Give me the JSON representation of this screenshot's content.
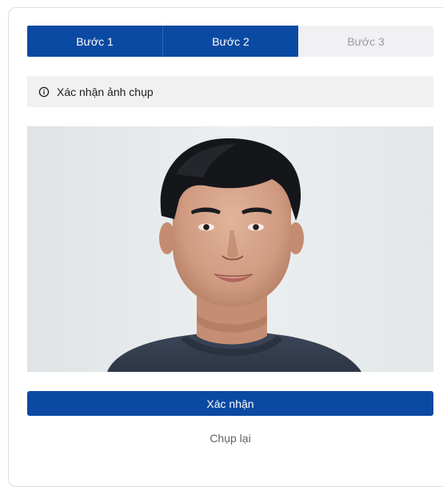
{
  "stepper": {
    "steps": [
      {
        "label": "Bước 1",
        "state": "active"
      },
      {
        "label": "Bước 2",
        "state": "active"
      },
      {
        "label": "Bước 3",
        "state": "pending"
      }
    ]
  },
  "notice": {
    "icon": "info-icon",
    "text": "Xác nhận ảnh chụp"
  },
  "photo": {
    "description_icon": "portrait-photo"
  },
  "actions": {
    "confirm_label": "Xác nhận",
    "retake_label": "Chụp lại"
  },
  "colors": {
    "primary": "#0b4aa2",
    "step_pending_bg": "#f1f1f4",
    "step_pending_text": "#9a9aa2",
    "notice_bg": "#f1f1f1"
  }
}
